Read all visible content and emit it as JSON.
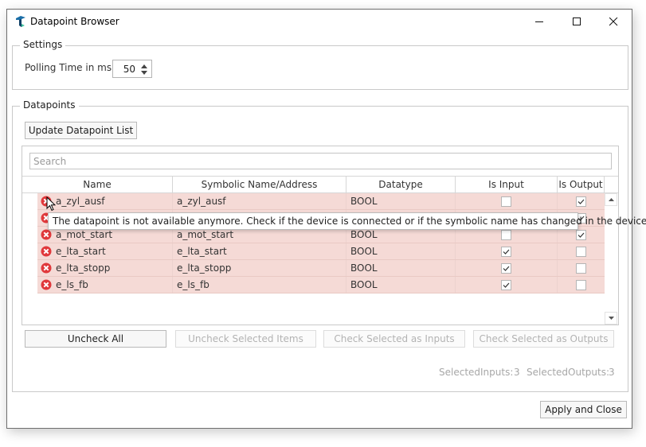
{
  "window": {
    "title": "Datapoint Browser",
    "icon": "app-logo-icon",
    "controls": [
      "minimize-icon",
      "maximize-icon",
      "close-icon"
    ]
  },
  "settings": {
    "group_label": "Settings",
    "polling_label": "Polling Time in ms:",
    "polling_value": "50"
  },
  "datapoints": {
    "group_label": "Datapoints",
    "update_button": "Update Datapoint List",
    "search_placeholder": "Search",
    "search_value": "",
    "columns": [
      "Name",
      "Symbolic Name/Address",
      "Datatype",
      "Is Input",
      "Is Output"
    ],
    "rows": [
      {
        "name": "a_zyl_ausf",
        "symbolic": "a_zyl_ausf",
        "datatype": "BOOL",
        "is_input": false,
        "is_output": true,
        "status": "error"
      },
      {
        "name": "",
        "symbolic": "",
        "datatype": "",
        "is_input": null,
        "is_output": true,
        "status": "error"
      },
      {
        "name": "a_mot_start",
        "symbolic": "a_mot_start",
        "datatype": "BOOL",
        "is_input": false,
        "is_output": true,
        "status": "error"
      },
      {
        "name": "e_lta_start",
        "symbolic": "e_lta_start",
        "datatype": "BOOL",
        "is_input": true,
        "is_output": false,
        "status": "error"
      },
      {
        "name": "e_lta_stopp",
        "symbolic": "e_lta_stopp",
        "datatype": "BOOL",
        "is_input": true,
        "is_output": false,
        "status": "error"
      },
      {
        "name": "e_ls_fb",
        "symbolic": "e_ls_fb",
        "datatype": "BOOL",
        "is_input": true,
        "is_output": false,
        "status": "error"
      }
    ],
    "tooltip": "The datapoint is not available anymore. Check if the device is connected or if the symbolic name has changed in the device!",
    "row_error_color": "#f5dad6",
    "error_icon_color": "#e0383b"
  },
  "actions": {
    "uncheck_all": "Uncheck All",
    "uncheck_selected": "Uncheck Selected Items",
    "check_inputs": "Check Selected as Inputs",
    "check_outputs": "Check Selected as Outputs"
  },
  "status": {
    "selected_inputs_label": "SelectedInputs:",
    "selected_inputs_value": "3",
    "selected_outputs_label": "SelectedOutputs:",
    "selected_outputs_value": "3"
  },
  "footer": {
    "apply_close": "Apply and Close"
  }
}
